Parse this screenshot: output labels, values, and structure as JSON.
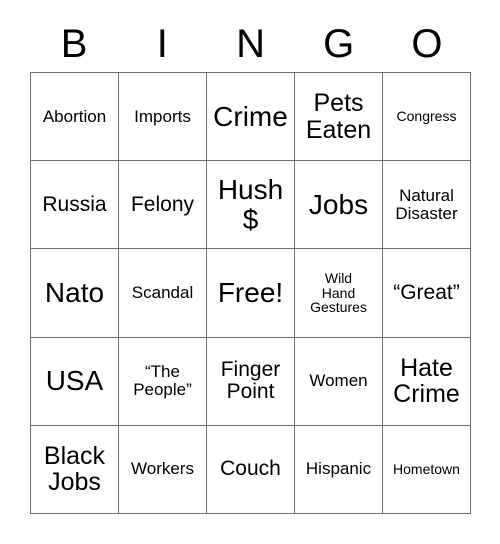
{
  "card": {
    "title": "BINGO",
    "header_letters": [
      "B",
      "I",
      "N",
      "G",
      "O"
    ],
    "border_color": "#6f6f6f",
    "text_color": "#000000",
    "background_color": "#ffffff",
    "rows": 5,
    "columns": 5,
    "cells": [
      {
        "text": "Abortion",
        "size": "sm"
      },
      {
        "text": "Imports",
        "size": "sm"
      },
      {
        "text": "Crime",
        "size": "xl"
      },
      {
        "text": "Pets\nEaten",
        "size": "lg"
      },
      {
        "text": "Congress",
        "size": "xs"
      },
      {
        "text": "Russia",
        "size": "md"
      },
      {
        "text": "Felony",
        "size": "md"
      },
      {
        "text": "Hush\n$",
        "size": "xl"
      },
      {
        "text": "Jobs",
        "size": "xl"
      },
      {
        "text": "Natural\nDisaster",
        "size": "sm"
      },
      {
        "text": "Nato",
        "size": "xl"
      },
      {
        "text": "Scandal",
        "size": "sm"
      },
      {
        "text": "Free!",
        "size": "xl"
      },
      {
        "text": "Wild\nHand\nGestures",
        "size": "xs"
      },
      {
        "text": "“Great”",
        "size": "md"
      },
      {
        "text": "USA",
        "size": "xl"
      },
      {
        "text": "“The\nPeople”",
        "size": "sm"
      },
      {
        "text": "Finger\nPoint",
        "size": "md"
      },
      {
        "text": "Women",
        "size": "sm"
      },
      {
        "text": "Hate\nCrime",
        "size": "lg"
      },
      {
        "text": "Black\nJobs",
        "size": "lg"
      },
      {
        "text": "Workers",
        "size": "sm"
      },
      {
        "text": "Couch",
        "size": "md"
      },
      {
        "text": "Hispanic",
        "size": "sm"
      },
      {
        "text": "Hometown",
        "size": "xs"
      }
    ]
  }
}
